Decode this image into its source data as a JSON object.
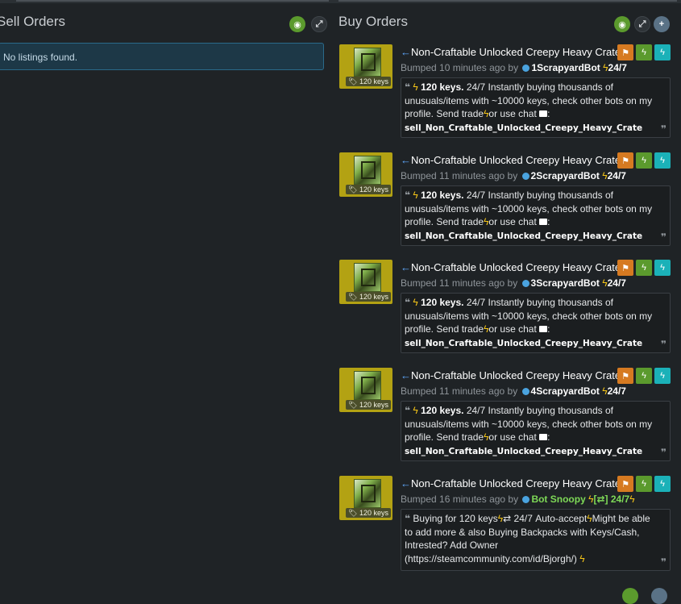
{
  "sell": {
    "title": "Sell Orders",
    "empty_message": "No listings found."
  },
  "buy": {
    "title": "Buy Orders",
    "listings": [
      {
        "title": "Non-Craftable Unlocked Creepy Heavy Crate",
        "price": "120 keys",
        "bumped": "Bumped 10 minutes ago by",
        "bot": "1ScrapyardBot",
        "tag": "24/7",
        "amount": "120 keys.",
        "line1": "24/7 Instantly buying thousands of",
        "line2": "unusuals/items with ~10000 keys, check other bots on my",
        "line3a": "profile. Send  trade",
        "line3b": "or  use  chat",
        "line3c": ":",
        "code": "sell_Non_Craftable_Unlocked_Creepy_Heavy_Crate"
      },
      {
        "title": "Non-Craftable Unlocked Creepy Heavy Crate",
        "price": "120 keys",
        "bumped": "Bumped 11 minutes ago by",
        "bot": "2ScrapyardBot",
        "tag": "24/7",
        "amount": "120 keys.",
        "line1": "24/7 Instantly buying thousands of",
        "line2": "unusuals/items with ~10000 keys, check other bots on my",
        "line3a": "profile. Send  trade",
        "line3b": "or  use  chat",
        "line3c": ":",
        "code": "sell_Non_Craftable_Unlocked_Creepy_Heavy_Crate"
      },
      {
        "title": "Non-Craftable Unlocked Creepy Heavy Crate",
        "price": "120 keys",
        "bumped": "Bumped 11 minutes ago by",
        "bot": "3ScrapyardBot",
        "tag": "24/7",
        "amount": "120 keys.",
        "line1": "24/7 Instantly buying thousands of",
        "line2": "unusuals/items with ~10000 keys, check other bots on my",
        "line3a": "profile. Send  trade",
        "line3b": "or  use  chat",
        "line3c": ":",
        "code": "sell_Non_Craftable_Unlocked_Creepy_Heavy_Crate"
      },
      {
        "title": "Non-Craftable Unlocked Creepy Heavy Crate",
        "price": "120 keys",
        "bumped": "Bumped 11 minutes ago by",
        "bot": "4ScrapyardBot",
        "tag": "24/7",
        "amount": "120 keys.",
        "line1": "24/7 Instantly buying thousands of",
        "line2": "unusuals/items with ~10000 keys, check other bots on my",
        "line3a": "profile. Send  trade",
        "line3b": "or  use  chat",
        "line3c": ":",
        "code": "sell_Non_Craftable_Unlocked_Creepy_Heavy_Crate"
      }
    ],
    "last": {
      "title": "Non-Craftable Unlocked Creepy Heavy Crate",
      "price": "120 keys",
      "bumped": "Bumped 16 minutes ago by",
      "bot": "Bot Snoopy",
      "tag": "[⇄] 24/7",
      "line1a": "Buying for 120 keys",
      "line1b": "⇄ 24/7 Auto-accept",
      "line1c": "Might be able",
      "line2": "to add more & also Buying Backpacks with Keys/Cash,",
      "line3": "Intrested? Add Owner",
      "line4": "(https://steamcommunity.com/id/Bjorgh/)"
    }
  },
  "colors": {
    "background": "#1f2326",
    "accent_green": "#5b9a2d",
    "flag_orange": "#d67a21",
    "bolt_cyan": "#1bb1b8",
    "info_blue": "#1d3847"
  },
  "icons": {
    "visibility": "eye-icon",
    "expand": "expand-icon",
    "add": "plus-icon",
    "report": "flag-icon",
    "bolt": "lightning-icon",
    "chat": "chat-icon",
    "quote": "quote-icon"
  }
}
